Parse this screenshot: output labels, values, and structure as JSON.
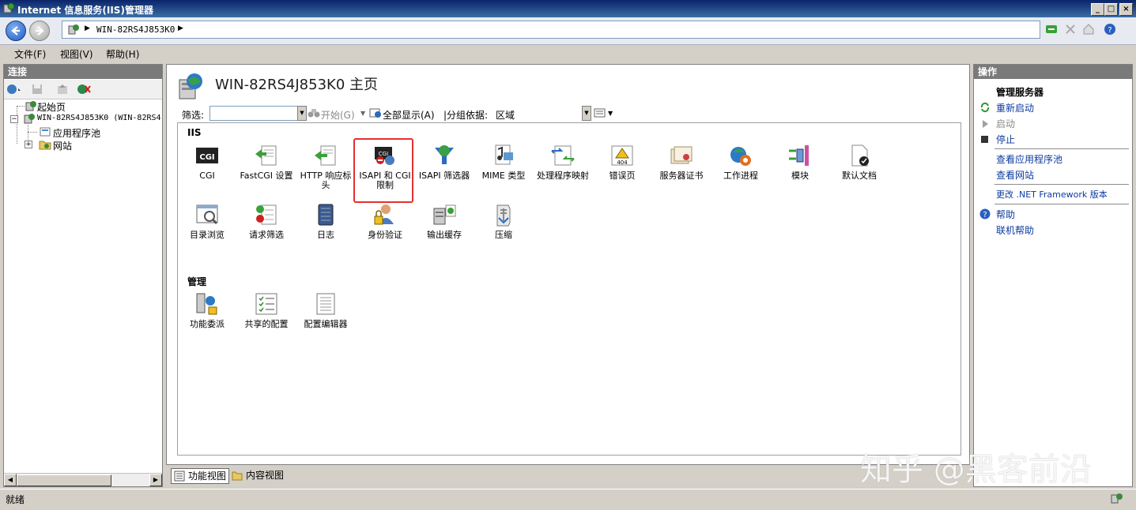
{
  "window": {
    "title": "Internet 信息服务(IIS)管理器"
  },
  "address": {
    "crumb": "WIN-82RS4J853K0"
  },
  "menu": [
    {
      "label": "文件(F)"
    },
    {
      "label": "视图(V)"
    },
    {
      "label": "帮助(H)"
    }
  ],
  "connections": {
    "header": "连接",
    "tree": [
      {
        "label": "起始页"
      },
      {
        "label": "WIN-82RS4J853K0 (WIN-82RS4"
      },
      {
        "label": "应用程序池"
      },
      {
        "label": "网站"
      }
    ]
  },
  "main": {
    "title": "WIN-82RS4J853K0 主页",
    "filter": {
      "label": "筛选:",
      "value": "",
      "start": "开始(G)",
      "show_all": "全部显示(A)",
      "group_label": "|分组依据:",
      "group_value": "区域"
    },
    "sections": [
      {
        "name": "IIS",
        "items": [
          {
            "label": "CGI",
            "icon": "cgi-icon"
          },
          {
            "label": "FastCGI 设置",
            "icon": "fastcgi-icon"
          },
          {
            "label": "HTTP 响应标头",
            "icon": "http-response-headers-icon"
          },
          {
            "label": "ISAPI 和 CGI 限制",
            "icon": "isapi-cgi-restrictions-icon"
          },
          {
            "label": "ISAPI 筛选器",
            "icon": "isapi-filters-icon"
          },
          {
            "label": "MIME 类型",
            "icon": "mime-types-icon"
          },
          {
            "label": "处理程序映射",
            "icon": "handler-mappings-icon"
          },
          {
            "label": "错误页",
            "icon": "error-pages-icon"
          },
          {
            "label": "服务器证书",
            "icon": "server-certificates-icon"
          },
          {
            "label": "工作进程",
            "icon": "worker-processes-icon"
          },
          {
            "label": "模块",
            "icon": "modules-icon"
          },
          {
            "label": "默认文档",
            "icon": "default-document-icon"
          },
          {
            "label": "目录浏览",
            "icon": "directory-browsing-icon"
          },
          {
            "label": "请求筛选",
            "icon": "request-filtering-icon"
          },
          {
            "label": "日志",
            "icon": "logging-icon"
          },
          {
            "label": "身份验证",
            "icon": "authentication-icon"
          },
          {
            "label": "输出缓存",
            "icon": "output-caching-icon"
          },
          {
            "label": "压缩",
            "icon": "compression-icon"
          }
        ]
      },
      {
        "name": "管理",
        "items": [
          {
            "label": "功能委派",
            "icon": "feature-delegation-icon"
          },
          {
            "label": "共享的配置",
            "icon": "shared-configuration-icon"
          },
          {
            "label": "配置编辑器",
            "icon": "configuration-editor-icon"
          }
        ]
      }
    ],
    "view_tabs": [
      {
        "label": "功能视图"
      },
      {
        "label": "内容视图"
      }
    ]
  },
  "actions": {
    "header": "操作",
    "group_title": "管理服务器",
    "items": [
      {
        "label": "重新启动",
        "enabled": true
      },
      {
        "label": "启动",
        "enabled": false
      },
      {
        "label": "停止",
        "enabled": true
      },
      {
        "label": "查看应用程序池",
        "enabled": true
      },
      {
        "label": "查看网站",
        "enabled": true
      },
      {
        "label": "更改 .NET Framework 版本",
        "enabled": true
      },
      {
        "label": "帮助",
        "enabled": true
      },
      {
        "label": "联机帮助",
        "enabled": true
      }
    ]
  },
  "status": {
    "text": "就绪"
  },
  "watermark": "知乎 @黑客前沿",
  "colors": {
    "title_bar": "#0a246a",
    "highlight_box": "#e53030",
    "link": "#0d3a9e"
  }
}
